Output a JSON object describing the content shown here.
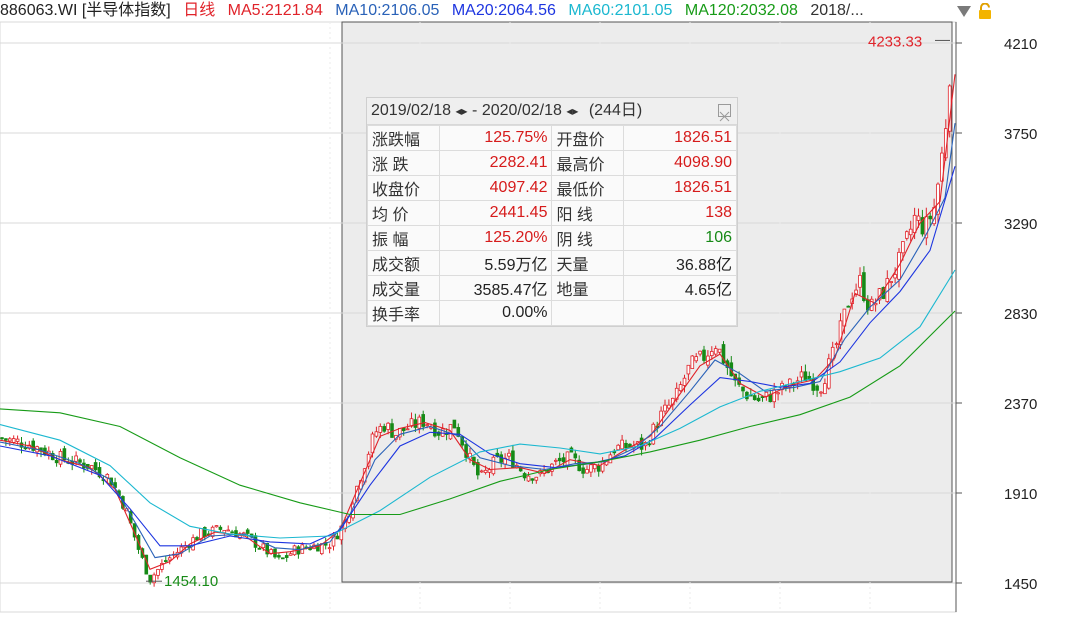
{
  "header": {
    "symbol": "886063.WI [半导体指数]",
    "period": "日线",
    "ma5": "MA5:2121.84",
    "ma10": "MA10:2106.05",
    "ma20": "MA20:2064.56",
    "ma60": "MA60:2101.05",
    "ma120": "MA120:2032.08",
    "date": "2018/..."
  },
  "colors": {
    "up": "#e0232a",
    "down": "#178a17",
    "ma5": "#e0232a",
    "ma10": "#2a62b8",
    "ma20": "#1d35e0",
    "ma60": "#1cb8d0",
    "ma120": "#179b17",
    "grid": "#d9d9d9",
    "selection": "#ececec"
  },
  "icons": {
    "dropdown": "triangle-down-icon",
    "lock": "lock-icon",
    "close": "close-icon"
  },
  "stats": {
    "range_start": "2019/02/18",
    "range_sep": "-",
    "range_end": "2020/02/18",
    "days": "(244日)",
    "rows": [
      {
        "l1": "涨跌幅",
        "v1": "125.75%",
        "c1": "red",
        "l2": "开盘价",
        "v2": "1826.51",
        "c2": "red"
      },
      {
        "l1": "涨 跌",
        "v1": "2282.41",
        "c1": "red",
        "l2": "最高价",
        "v2": "4098.90",
        "c2": "red"
      },
      {
        "l1": "收盘价",
        "v1": "4097.42",
        "c1": "red",
        "l2": "最低价",
        "v2": "1826.51",
        "c2": "red"
      },
      {
        "l1": "均 价",
        "v1": "2441.45",
        "c1": "red",
        "l2": "阳 线",
        "v2": "138",
        "c2": "red"
      },
      {
        "l1": "振 幅",
        "v1": "125.20%",
        "c1": "red",
        "l2": "阴 线",
        "v2": "106",
        "c2": "green"
      },
      {
        "l1": "成交额",
        "v1": "5.59万亿",
        "c1": "blk",
        "l2": "天量",
        "v2": "36.88亿",
        "c2": "blk"
      },
      {
        "l1": "成交量",
        "v1": "3585.47亿",
        "c1": "blk",
        "l2": "地量",
        "v2": "4.65亿",
        "c2": "blk"
      },
      {
        "l1": "换手率",
        "v1": "0.00%",
        "c1": "blk",
        "l2": "",
        "v2": "",
        "c2": "blk"
      }
    ]
  },
  "chart_data": {
    "type": "candlestick",
    "y_ticks": [
      4210,
      3750,
      3290,
      2830,
      2370,
      1910,
      1450
    ],
    "ylim": [
      1450,
      4230
    ],
    "grid": true,
    "annotations": [
      {
        "text": "4233.33",
        "value": 4233.33,
        "at": "max"
      },
      {
        "text": "1454.10",
        "value": 1454.1,
        "at": "min"
      }
    ],
    "close_path_points": [
      [
        0,
        2190
      ],
      [
        30,
        2160
      ],
      [
        60,
        2090
      ],
      [
        90,
        2050
      ],
      [
        110,
        1985
      ],
      [
        125,
        1840
      ],
      [
        140,
        1600
      ],
      [
        150,
        1470
      ],
      [
        165,
        1560
      ],
      [
        180,
        1620
      ],
      [
        200,
        1700
      ],
      [
        225,
        1730
      ],
      [
        245,
        1690
      ],
      [
        265,
        1620
      ],
      [
        280,
        1560
      ],
      [
        295,
        1620
      ],
      [
        315,
        1640
      ],
      [
        330,
        1650
      ],
      [
        345,
        1760
      ],
      [
        360,
        1990
      ],
      [
        375,
        2220
      ],
      [
        385,
        2260
      ],
      [
        395,
        2210
      ],
      [
        410,
        2250
      ],
      [
        425,
        2280
      ],
      [
        440,
        2220
      ],
      [
        455,
        2260
      ],
      [
        470,
        2080
      ],
      [
        480,
        1980
      ],
      [
        495,
        2070
      ],
      [
        510,
        2090
      ],
      [
        525,
        2010
      ],
      [
        540,
        2000
      ],
      [
        555,
        2060
      ],
      [
        570,
        2090
      ],
      [
        585,
        2030
      ],
      [
        600,
        2050
      ],
      [
        615,
        2140
      ],
      [
        630,
        2150
      ],
      [
        645,
        2150
      ],
      [
        660,
        2300
      ],
      [
        675,
        2390
      ],
      [
        690,
        2560
      ],
      [
        705,
        2610
      ],
      [
        715,
        2680
      ],
      [
        725,
        2580
      ],
      [
        735,
        2470
      ],
      [
        745,
        2420
      ],
      [
        760,
        2380
      ],
      [
        775,
        2420
      ],
      [
        790,
        2460
      ],
      [
        805,
        2510
      ],
      [
        820,
        2450
      ],
      [
        835,
        2640
      ],
      [
        850,
        2920
      ],
      [
        860,
        2990
      ],
      [
        870,
        2850
      ],
      [
        885,
        2950
      ],
      [
        900,
        3100
      ],
      [
        915,
        3320
      ],
      [
        925,
        3260
      ],
      [
        935,
        3380
      ],
      [
        945,
        3750
      ],
      [
        952,
        4210
      ]
    ],
    "ma_series": [
      {
        "name": "MA5",
        "points": [
          [
            0,
            2180
          ],
          [
            30,
            2150
          ],
          [
            60,
            2080
          ],
          [
            90,
            2040
          ],
          [
            115,
            1930
          ],
          [
            135,
            1700
          ],
          [
            150,
            1520
          ],
          [
            170,
            1560
          ],
          [
            190,
            1650
          ],
          [
            215,
            1710
          ],
          [
            245,
            1690
          ],
          [
            270,
            1600
          ],
          [
            290,
            1610
          ],
          [
            320,
            1640
          ],
          [
            340,
            1720
          ],
          [
            360,
            1960
          ],
          [
            380,
            2200
          ],
          [
            400,
            2240
          ],
          [
            425,
            2270
          ],
          [
            450,
            2230
          ],
          [
            470,
            2080
          ],
          [
            490,
            2030
          ],
          [
            520,
            2040
          ],
          [
            545,
            2010
          ],
          [
            570,
            2080
          ],
          [
            600,
            2050
          ],
          [
            625,
            2130
          ],
          [
            650,
            2200
          ],
          [
            675,
            2380
          ],
          [
            700,
            2560
          ],
          [
            720,
            2620
          ],
          [
            740,
            2470
          ],
          [
            765,
            2400
          ],
          [
            790,
            2460
          ],
          [
            815,
            2490
          ],
          [
            835,
            2600
          ],
          [
            855,
            2930
          ],
          [
            875,
            2880
          ],
          [
            900,
            3080
          ],
          [
            920,
            3290
          ],
          [
            940,
            3400
          ],
          [
            955,
            4050
          ]
        ]
      },
      {
        "name": "MA10",
        "points": [
          [
            0,
            2170
          ],
          [
            40,
            2130
          ],
          [
            80,
            2060
          ],
          [
            110,
            1980
          ],
          [
            135,
            1760
          ],
          [
            155,
            1580
          ],
          [
            180,
            1600
          ],
          [
            210,
            1690
          ],
          [
            245,
            1700
          ],
          [
            275,
            1630
          ],
          [
            300,
            1620
          ],
          [
            330,
            1660
          ],
          [
            350,
            1800
          ],
          [
            375,
            2080
          ],
          [
            400,
            2210
          ],
          [
            430,
            2250
          ],
          [
            460,
            2200
          ],
          [
            480,
            2090
          ],
          [
            510,
            2050
          ],
          [
            545,
            2030
          ],
          [
            575,
            2060
          ],
          [
            605,
            2070
          ],
          [
            635,
            2140
          ],
          [
            660,
            2250
          ],
          [
            690,
            2430
          ],
          [
            715,
            2590
          ],
          [
            740,
            2520
          ],
          [
            765,
            2430
          ],
          [
            795,
            2450
          ],
          [
            820,
            2480
          ],
          [
            845,
            2700
          ],
          [
            870,
            2860
          ],
          [
            900,
            3000
          ],
          [
            925,
            3220
          ],
          [
            945,
            3420
          ],
          [
            955,
            3800
          ]
        ]
      },
      {
        "name": "MA20",
        "points": [
          [
            0,
            2150
          ],
          [
            50,
            2100
          ],
          [
            100,
            2000
          ],
          [
            130,
            1830
          ],
          [
            160,
            1640
          ],
          [
            190,
            1640
          ],
          [
            230,
            1690
          ],
          [
            270,
            1660
          ],
          [
            310,
            1650
          ],
          [
            340,
            1720
          ],
          [
            370,
            1950
          ],
          [
            400,
            2150
          ],
          [
            430,
            2220
          ],
          [
            460,
            2210
          ],
          [
            490,
            2110
          ],
          [
            520,
            2060
          ],
          [
            555,
            2040
          ],
          [
            590,
            2060
          ],
          [
            625,
            2100
          ],
          [
            655,
            2190
          ],
          [
            690,
            2360
          ],
          [
            720,
            2500
          ],
          [
            750,
            2480
          ],
          [
            780,
            2450
          ],
          [
            810,
            2470
          ],
          [
            840,
            2580
          ],
          [
            870,
            2780
          ],
          [
            900,
            2940
          ],
          [
            930,
            3150
          ],
          [
            955,
            3580
          ]
        ]
      },
      {
        "name": "MA60",
        "points": [
          [
            0,
            2260
          ],
          [
            60,
            2180
          ],
          [
            110,
            2050
          ],
          [
            150,
            1860
          ],
          [
            190,
            1740
          ],
          [
            230,
            1700
          ],
          [
            280,
            1680
          ],
          [
            330,
            1690
          ],
          [
            380,
            1820
          ],
          [
            430,
            1990
          ],
          [
            480,
            2120
          ],
          [
            520,
            2160
          ],
          [
            560,
            2140
          ],
          [
            600,
            2110
          ],
          [
            640,
            2150
          ],
          [
            680,
            2240
          ],
          [
            720,
            2350
          ],
          [
            760,
            2430
          ],
          [
            800,
            2480
          ],
          [
            840,
            2530
          ],
          [
            880,
            2600
          ],
          [
            920,
            2760
          ],
          [
            955,
            3050
          ]
        ]
      },
      {
        "name": "MA120",
        "points": [
          [
            0,
            2340
          ],
          [
            60,
            2320
          ],
          [
            120,
            2250
          ],
          [
            180,
            2090
          ],
          [
            240,
            1950
          ],
          [
            300,
            1860
          ],
          [
            350,
            1800
          ],
          [
            400,
            1800
          ],
          [
            450,
            1880
          ],
          [
            500,
            1970
          ],
          [
            550,
            2030
          ],
          [
            600,
            2070
          ],
          [
            650,
            2120
          ],
          [
            700,
            2180
          ],
          [
            750,
            2250
          ],
          [
            800,
            2310
          ],
          [
            850,
            2400
          ],
          [
            900,
            2560
          ],
          [
            955,
            2840
          ]
        ]
      }
    ]
  }
}
